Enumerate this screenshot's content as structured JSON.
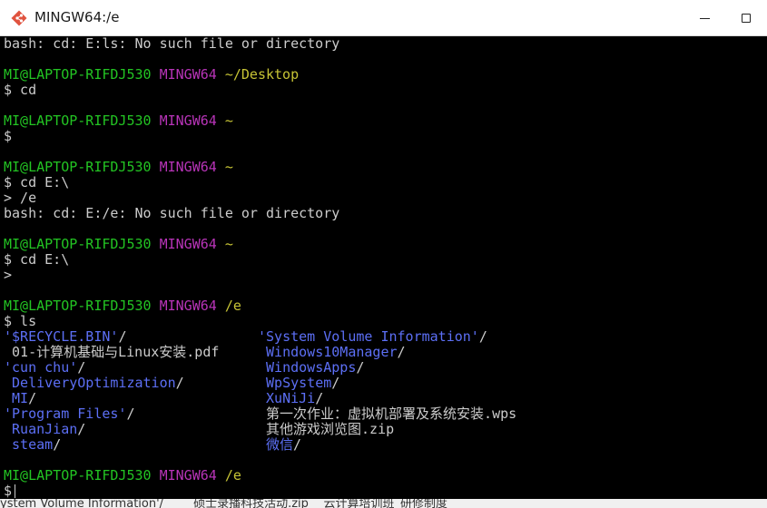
{
  "window": {
    "title": "MINGW64:/e",
    "icon": "git-bash-icon"
  },
  "colors": {
    "user_host": "#23c423",
    "shell": "#b834b8",
    "path": "#c7c435",
    "dir": "#5c6ff5",
    "text": "#cccccc"
  },
  "terminal": {
    "lines": {
      "l1": "bash: cd: E:ls: No such file or directory",
      "l4": "$ cd",
      "l7": "$",
      "l10": "$ cd E:\\",
      "l11": "> /e",
      "l12": "bash: cd: E:/e: No such file or directory",
      "l15": "$ cd E:\\",
      "l16": ">",
      "l19": "$ ls",
      "l31": "$"
    },
    "prompts": [
      {
        "user": "MI@LAPTOP-RIFDJ530",
        "shell": "MINGW64",
        "path": "~/Desktop"
      },
      {
        "user": "MI@LAPTOP-RIFDJ530",
        "shell": "MINGW64",
        "path": "~"
      },
      {
        "user": "MI@LAPTOP-RIFDJ530",
        "shell": "MINGW64",
        "path": "~"
      },
      {
        "user": "MI@LAPTOP-RIFDJ530",
        "shell": "MINGW64",
        "path": "~"
      },
      {
        "user": "MI@LAPTOP-RIFDJ530",
        "shell": "MINGW64",
        "path": "/e"
      },
      {
        "user": "MI@LAPTOP-RIFDJ530",
        "shell": "MINGW64",
        "path": "/e"
      }
    ],
    "ls": {
      "col1": [
        {
          "name": "'$RECYCLE.BIN'",
          "suffix": "/"
        },
        {
          "name": "",
          "suffix": " 01-计算机基础与Linux安装.pdf"
        },
        {
          "name": "'cun chu'",
          "suffix": "/"
        },
        {
          "name": " DeliveryOptimization",
          "suffix": "/"
        },
        {
          "name": " MI",
          "suffix": "/"
        },
        {
          "name": "'Program Files'",
          "suffix": "/"
        },
        {
          "name": " RuanJian",
          "suffix": "/"
        },
        {
          "name": " steam",
          "suffix": "/"
        }
      ],
      "col2": [
        {
          "name": "'System Volume Information'",
          "suffix": "/"
        },
        {
          "name": " Windows10Manager",
          "suffix": "/"
        },
        {
          "name": " WindowsApps",
          "suffix": "/"
        },
        {
          "name": " WpSystem",
          "suffix": "/"
        },
        {
          "name": " XuNiJi",
          "suffix": "/"
        },
        {
          "name": "",
          "suffix": " 第一次作业：虚拟机部署及系统安装.wps"
        },
        {
          "name": "",
          "suffix": " 其他游戏浏览图.zip"
        },
        {
          "name": " 微信",
          "suffix": "/"
        }
      ]
    }
  },
  "background_window": {
    "text": "ystem Volume Information'/        硕士录播科技活动.zip    云计算培训班_研修制度"
  }
}
